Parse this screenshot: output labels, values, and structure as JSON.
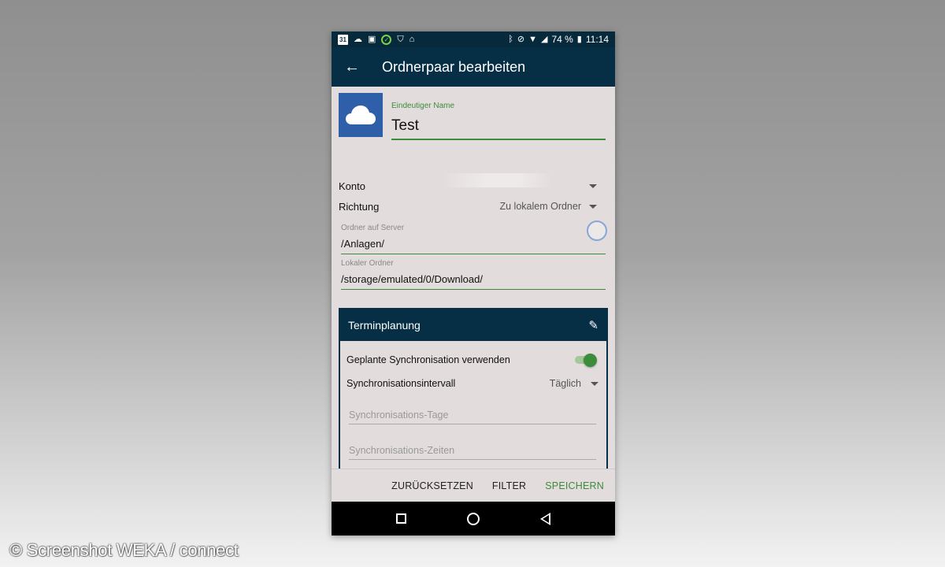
{
  "status_bar": {
    "battery": "74 %",
    "time": "11:14",
    "calendar_day": "31",
    "icons": [
      "calendar-icon",
      "cloud-icon",
      "image-icon",
      "check-icon",
      "shield-icon",
      "bank-icon",
      "bluetooth-icon",
      "mute-icon",
      "wifi-icon",
      "signal-icon",
      "battery-icon"
    ]
  },
  "app_bar": {
    "title": "Ordnerpaar bearbeiten",
    "back_icon": "arrow-left-icon"
  },
  "form": {
    "name_label": "Eindeutiger Name",
    "name_value": "Test",
    "konto_label": "Konto",
    "richtung_label": "Richtung",
    "richtung_value": "Zu lokalem Ordner",
    "server_folder_label": "Ordner auf Server",
    "server_folder_value": "/Anlagen/",
    "local_folder_label": "Lokaler Ordner",
    "local_folder_value": "/storage/emulated/0/Download/"
  },
  "schedule_card": {
    "title": "Terminplanung",
    "use_sync_label": "Geplante Synchronisation verwenden",
    "use_sync_enabled": true,
    "interval_label": "Synchronisationsintervall",
    "interval_value": "Täglich",
    "days_placeholder": "Synchronisations-Tage",
    "times_placeholder": "Synchronisations-Zeiten"
  },
  "actions": {
    "reset": "ZURÜCKSETZEN",
    "filter": "FILTER",
    "save": "SPEICHERN"
  },
  "colors": {
    "primary_dark": "#062e45",
    "accent_green": "#3c8c3c",
    "onedrive_blue": "#2e5fa8"
  },
  "watermark": "© Screenshot WEKA / connect"
}
